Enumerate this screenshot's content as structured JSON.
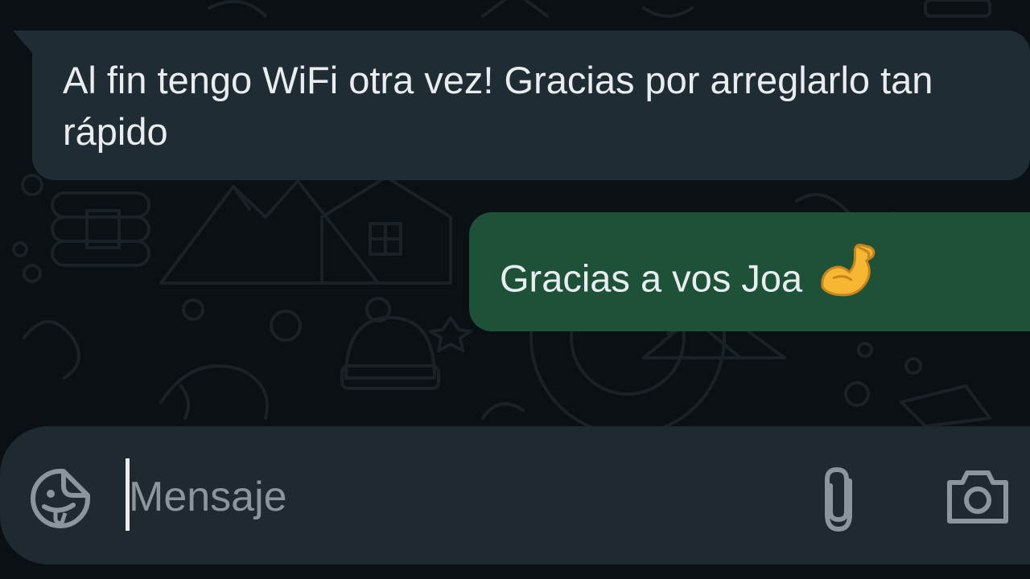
{
  "messages": [
    {
      "direction": "incoming",
      "text": "Al fin tengo WiFi otra vez! Gracias por arreglarlo tan rápido"
    },
    {
      "direction": "outgoing",
      "text": "Gracias a vos Joa",
      "emoji": "flexed-biceps"
    }
  ],
  "composer": {
    "placeholder": "Mensaje",
    "value": "",
    "left_icon": "sticker-icon",
    "right_icons": [
      "paperclip-icon",
      "camera-icon"
    ]
  },
  "colors": {
    "background": "#0b1014",
    "incoming_bubble": "#202c33",
    "outgoing_bubble": "#1d5239",
    "composer": "#1f2a30",
    "text": "#e9edef",
    "icon": "#8a969c"
  }
}
